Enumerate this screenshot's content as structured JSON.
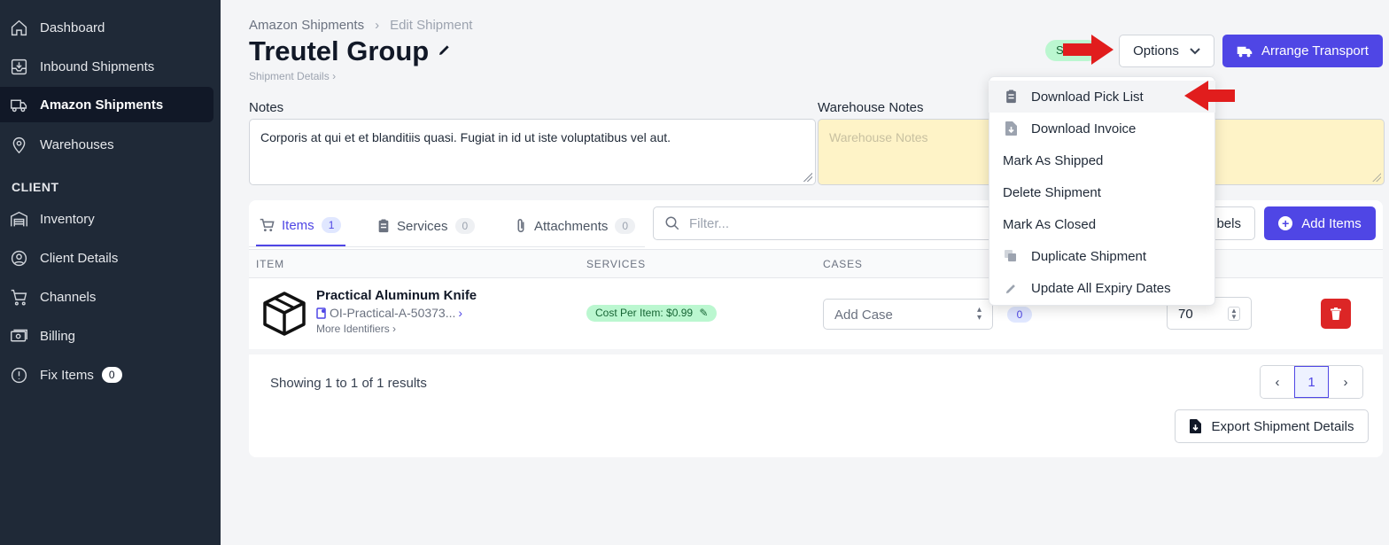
{
  "sidebar": {
    "items": [
      {
        "label": "Dashboard",
        "icon": "home-icon"
      },
      {
        "label": "Inbound Shipments",
        "icon": "inbox-icon"
      },
      {
        "label": "Amazon Shipments",
        "icon": "truck-icon",
        "active": true
      },
      {
        "label": "Warehouses",
        "icon": "map-pin-icon"
      }
    ],
    "section_label": "CLIENT",
    "client_items": [
      {
        "label": "Inventory",
        "icon": "warehouse-icon"
      },
      {
        "label": "Client Details",
        "icon": "user-circle-icon"
      },
      {
        "label": "Channels",
        "icon": "cart-icon"
      },
      {
        "label": "Billing",
        "icon": "money-icon"
      },
      {
        "label": "Fix Items",
        "icon": "alert-icon",
        "badge": "0"
      }
    ]
  },
  "header": {
    "breadcrumb": [
      "Amazon Shipments",
      "Edit Shipment"
    ],
    "title": "Treutel Group",
    "sub_link": "Shipment Details",
    "status": "S",
    "options_label": "Options",
    "arrange_label": "Arrange Transport"
  },
  "notes": {
    "label": "Notes",
    "value": "Corporis at qui et et blanditiis quasi. Fugiat in id ut iste voluptatibus vel aut.",
    "warehouse_label": "Warehouse Notes",
    "warehouse_placeholder": "Warehouse Notes"
  },
  "tabs": [
    {
      "label": "Items",
      "count": "1"
    },
    {
      "label": "Services",
      "count": "0"
    },
    {
      "label": "Attachments",
      "count": "0"
    }
  ],
  "toolbar": {
    "filter_placeholder": "Filter...",
    "labels_label": "bels",
    "add_items_label": "Add Items"
  },
  "table": {
    "headers": [
      "ITEM",
      "SERVICES",
      "CASES"
    ],
    "row": {
      "name": "Practical Aluminum Knife",
      "sku": "OI-Practical-A-50373...",
      "more": "More Identifiers",
      "service": "Cost Per Item: $0.99",
      "case_placeholder": "Add Case",
      "case_count": "0",
      "quantity": "70"
    }
  },
  "footer": {
    "results_prefix": "Showing",
    "from": "1",
    "to_word": "to",
    "to": "1",
    "of_word": "of",
    "total": "1",
    "results_word": "results",
    "page": "1",
    "export_label": "Export Shipment Details"
  },
  "dropdown": {
    "items": [
      {
        "label": "Download Pick List",
        "icon": "clipboard-icon"
      },
      {
        "label": "Download Invoice",
        "icon": "file-download-icon"
      },
      {
        "label": "Mark As Shipped",
        "icon": ""
      },
      {
        "label": "Delete Shipment",
        "icon": ""
      },
      {
        "label": "Mark As Closed",
        "icon": ""
      },
      {
        "label": "Duplicate Shipment",
        "icon": "copy-icon"
      },
      {
        "label": "Update All Expiry Dates",
        "icon": "pencil-icon"
      }
    ]
  },
  "colors": {
    "sidebar_bg": "#1f2937",
    "primary": "#4f46e5",
    "danger": "#dc2626",
    "success_bg": "#bbf7d0",
    "warehouse_notes_bg": "#fef3c7",
    "annotation_arrow": "#e11d1d"
  }
}
